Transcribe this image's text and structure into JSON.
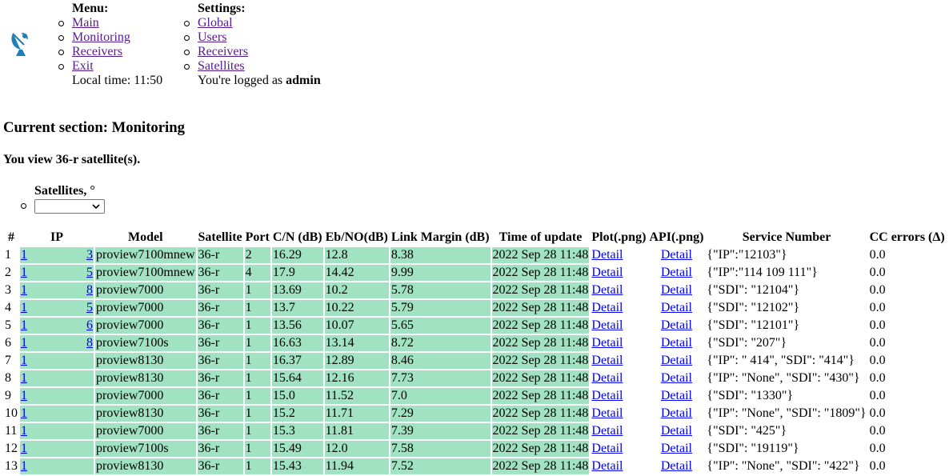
{
  "header": {
    "menu_title": "Menu:",
    "menu_items": [
      {
        "label": "Main",
        "visited": true
      },
      {
        "label": "Monitoring",
        "visited": true
      },
      {
        "label": "Receivers",
        "visited": true
      },
      {
        "label": "Exit",
        "visited": true
      }
    ],
    "local_time": "Local time: 11:50",
    "settings_title": "Settings:",
    "settings_items": [
      {
        "label": "Global",
        "visited": true
      },
      {
        "label": "Users",
        "visited": true
      },
      {
        "label": "Receivers",
        "visited": true
      },
      {
        "label": "Satellites",
        "visited": true
      }
    ],
    "logged_prefix": "You're logged as ",
    "logged_user": "admin"
  },
  "section_title": "Current section: Monitoring",
  "viewing_text": "You view 36-r satellite(s).",
  "filter": {
    "label": "Satellites, °",
    "selected": ""
  },
  "table": {
    "headers": [
      "#",
      "IP",
      "Model",
      "Satellite",
      "Port",
      "C/N (dB)",
      "Eb/NO(dB)",
      "Link Margin (dB)",
      "Time of update",
      "Plot(.png)",
      "API(.png)",
      "Service Number",
      "CC errors (Δ)"
    ],
    "detail_label": "Detail",
    "rows": [
      {
        "n": "1",
        "ip_l": "1",
        "ip_r": "3",
        "model": "proview7100mnew",
        "sat": "36-r",
        "port": "2",
        "cn": "16.29",
        "ebno": "12.8",
        "lm": "8.38",
        "time": "2022 Sep 28 11:48",
        "svc": "{\"IP\":\"12103\"}",
        "cc": "0.0"
      },
      {
        "n": "2",
        "ip_l": "1",
        "ip_r": "5",
        "model": "proview7100mnew",
        "sat": "36-r",
        "port": "4",
        "cn": "17.9",
        "ebno": "14.42",
        "lm": "9.99",
        "time": "2022 Sep 28 11:48",
        "svc": "{\"IP\":\"114 109 111\"}",
        "cc": "0.0"
      },
      {
        "n": "3",
        "ip_l": "1",
        "ip_r": "8",
        "model": "proview7000",
        "sat": "36-r",
        "port": "1",
        "cn": "13.69",
        "ebno": "10.2",
        "lm": "5.78",
        "time": "2022 Sep 28 11:48",
        "svc": "{\"SDI\": \"12104\"}",
        "cc": "0.0"
      },
      {
        "n": "4",
        "ip_l": "1",
        "ip_r": "5",
        "model": "proview7000",
        "sat": "36-r",
        "port": "1",
        "cn": "13.7",
        "ebno": "10.22",
        "lm": "5.79",
        "time": "2022 Sep 28 11:48",
        "svc": "{\"SDI\": \"12102\"}",
        "cc": "0.0"
      },
      {
        "n": "5",
        "ip_l": "1",
        "ip_r": "6",
        "model": "proview7000",
        "sat": "36-r",
        "port": "1",
        "cn": "13.56",
        "ebno": "10.07",
        "lm": "5.65",
        "time": "2022 Sep 28 11:48",
        "svc": "{\"SDI\": \"12101\"}",
        "cc": "0.0"
      },
      {
        "n": "6",
        "ip_l": "1",
        "ip_r": "8",
        "model": "proview7100s",
        "sat": "36-r",
        "port": "1",
        "cn": "16.63",
        "ebno": "13.14",
        "lm": "8.72",
        "time": "2022 Sep 28 11:48",
        "svc": "{\"SDI\": \"207\"}",
        "cc": "0.0"
      },
      {
        "n": "7",
        "ip_l": "1",
        "ip_r": "",
        "model": "proview8130",
        "sat": "36-r",
        "port": "1",
        "cn": "16.37",
        "ebno": "12.89",
        "lm": "8.46",
        "time": "2022 Sep 28 11:48",
        "svc": "{\"IP\": \" 414\", \"SDI\": \"414\"}",
        "cc": "0.0"
      },
      {
        "n": "8",
        "ip_l": "1",
        "ip_r": "",
        "model": "proview8130",
        "sat": "36-r",
        "port": "1",
        "cn": "15.64",
        "ebno": "12.16",
        "lm": "7.73",
        "time": "2022 Sep 28 11:48",
        "svc": "{\"IP\": \"None\", \"SDI\": \"430\"}",
        "cc": "0.0"
      },
      {
        "n": "9",
        "ip_l": "1",
        "ip_r": "",
        "model": "proview7000",
        "sat": "36-r",
        "port": "1",
        "cn": "15.0",
        "ebno": "11.52",
        "lm": "7.0",
        "time": "2022 Sep 28 11:48",
        "svc": "{\"SDI\": \"1330\"}",
        "cc": "0.0"
      },
      {
        "n": "10",
        "ip_l": "1",
        "ip_r": "",
        "model": "proview8130",
        "sat": "36-r",
        "port": "1",
        "cn": "15.2",
        "ebno": "11.71",
        "lm": "7.29",
        "time": "2022 Sep 28 11:48",
        "svc": "{\"IP\": \"None\", \"SDI\": \"1809\"}",
        "cc": "0.0"
      },
      {
        "n": "11",
        "ip_l": "1",
        "ip_r": "",
        "model": "proview7000",
        "sat": "36-r",
        "port": "1",
        "cn": "15.3",
        "ebno": "11.81",
        "lm": "7.39",
        "time": "2022 Sep 28 11:48",
        "svc": "{\"SDI\": \"425\"}",
        "cc": "0.0"
      },
      {
        "n": "12",
        "ip_l": "1",
        "ip_r": "",
        "model": "proview7100s",
        "sat": "36-r",
        "port": "1",
        "cn": "15.49",
        "ebno": "12.0",
        "lm": "7.58",
        "time": "2022 Sep 28 11:48",
        "svc": "{\"SDI\": \"19119\"}",
        "cc": "0.0"
      },
      {
        "n": "13",
        "ip_l": "1",
        "ip_r": "",
        "model": "proview8130",
        "sat": "36-r",
        "port": "1",
        "cn": "15.43",
        "ebno": "11.94",
        "lm": "7.52",
        "time": "2022 Sep 28 11:48",
        "svc": "{\"IP\": \"None\", \"SDI\": \"422\"}",
        "cc": "0.0"
      }
    ]
  },
  "colors": {
    "row_green": "#a0e2c2",
    "link": "#0000ee",
    "visited_link": "#551a8b",
    "logo_blue": "#1f7fb8"
  },
  "icons": {
    "logo": "satellite-dish-icon",
    "select": "chevron-down-icon"
  }
}
